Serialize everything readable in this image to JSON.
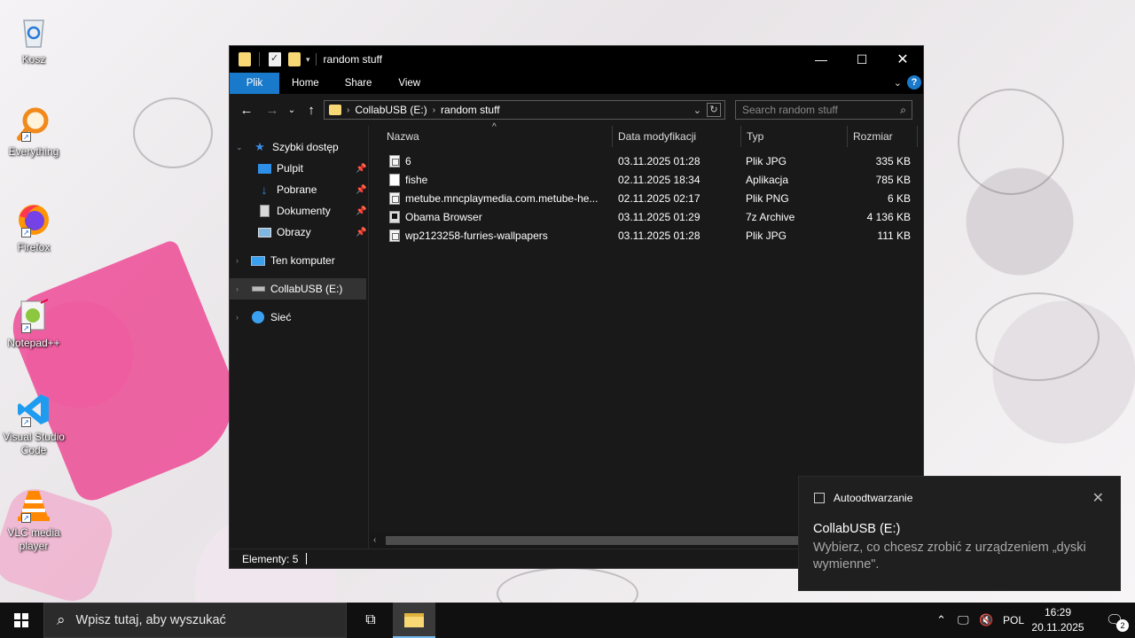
{
  "desktop": {
    "icons": [
      {
        "label": "Kosz",
        "icon": "recycle-bin-icon"
      },
      {
        "label": "Everything",
        "icon": "everything-search-icon"
      },
      {
        "label": "Firefox",
        "icon": "firefox-icon"
      },
      {
        "label": "Notepad++",
        "icon": "notepad-plus-plus-icon"
      },
      {
        "label": "Visual Studio Code",
        "icon": "vscode-icon"
      },
      {
        "label": "VLC media player",
        "icon": "vlc-icon"
      }
    ]
  },
  "window": {
    "title": "random stuff",
    "controls": {
      "minimize": "—",
      "maximize": "☐",
      "close": "✕"
    },
    "ribbon_tabs": [
      "Plik",
      "Home",
      "Share",
      "View"
    ],
    "breadcrumb": [
      "CollabUSB (E:)",
      "random stuff"
    ],
    "search_placeholder": "Search random stuff",
    "nav_pane": {
      "quick_access": "Szybki dostęp",
      "quick_items": [
        "Pulpit",
        "Pobrane",
        "Dokumenty",
        "Obrazy"
      ],
      "this_pc": "Ten komputer",
      "usb": "CollabUSB (E:)",
      "network": "Sieć"
    },
    "columns": {
      "name": "Nazwa",
      "modified": "Data modyfikacji",
      "type": "Typ",
      "size": "Rozmiar"
    },
    "files": [
      {
        "name": "6",
        "modified": "03.11.2025 01:28",
        "type": "Plik JPG",
        "size": "335 KB",
        "icon": "image-file-icon"
      },
      {
        "name": "fishe",
        "modified": "02.11.2025 18:34",
        "type": "Aplikacja",
        "size": "785 KB",
        "icon": "application-file-icon"
      },
      {
        "name": "metube.mncplaymedia.com.metube-he...",
        "modified": "02.11.2025 02:17",
        "type": "Plik PNG",
        "size": "6 KB",
        "icon": "image-file-icon"
      },
      {
        "name": "Obama Browser",
        "modified": "03.11.2025 01:29",
        "type": "7z Archive",
        "size": "4 136 KB",
        "icon": "archive-file-icon"
      },
      {
        "name": "wp2123258-furries-wallpapers",
        "modified": "03.11.2025 01:28",
        "type": "Plik JPG",
        "size": "111 KB",
        "icon": "image-file-icon"
      }
    ],
    "status": "Elementy: 5"
  },
  "toast": {
    "app": "Autoodtwarzanie",
    "title": "CollabUSB (E:)",
    "message": "Wybierz, co chcesz zrobić z urządzeniem „dyski wymienne\"."
  },
  "taskbar": {
    "search_placeholder": "Wpisz tutaj, aby wyszukać",
    "language": "POL",
    "time": "16:29",
    "date": "20.11.2025",
    "notification_count": "2"
  },
  "colors": {
    "accent": "#1979ca",
    "folder": "#f8d775",
    "window_bg": "#191919"
  }
}
